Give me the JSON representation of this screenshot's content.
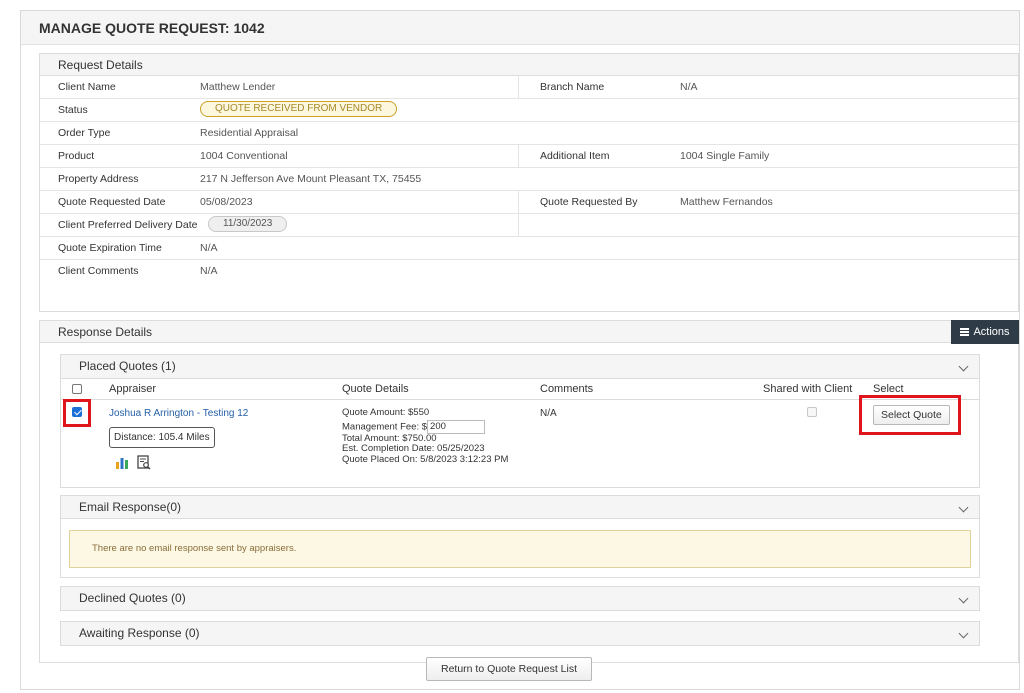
{
  "page": {
    "title": "MANAGE QUOTE REQUEST: 1042",
    "return_button": "Return to Quote Request List"
  },
  "request_details": {
    "title": "Request Details",
    "client_name_label": "Client Name",
    "client_name": "Matthew Lender",
    "branch_name_label": "Branch Name",
    "branch_name": "N/A",
    "status_label": "Status",
    "status": "QUOTE RECEIVED FROM VENDOR",
    "order_type_label": "Order Type",
    "order_type": "Residential Appraisal",
    "product_label": "Product",
    "product": "1004 Conventional",
    "additional_item_label": "Additional Item",
    "additional_item": "1004 Single Family",
    "property_address_label": "Property Address",
    "property_address": "217 N Jefferson Ave Mount Pleasant TX, 75455",
    "quote_requested_date_label": "Quote Requested Date",
    "quote_requested_date": "05/08/2023",
    "quote_requested_by_label": "Quote Requested By",
    "quote_requested_by": "Matthew Fernandos",
    "preferred_delivery_label": "Client Preferred Delivery Date",
    "preferred_delivery": "11/30/2023",
    "quote_expiration_label": "Quote Expiration Time",
    "quote_expiration": "N/A",
    "client_comments_label": "Client Comments",
    "client_comments": "N/A"
  },
  "response_details": {
    "title": "Response Details",
    "actions_label": "Actions",
    "placed_quotes": {
      "title": "Placed Quotes (1)",
      "columns": {
        "appraiser": "Appraiser",
        "quote_details": "Quote Details",
        "comments": "Comments",
        "shared": "Shared with Client",
        "select": "Select"
      },
      "rows": [
        {
          "appraiser": "Joshua R Arrington - Testing 12",
          "distance": "Distance: 105.4 Miles",
          "quote_amount": "Quote Amount:  $550",
          "management_fee_label": "Management Fee: $",
          "management_fee": "200",
          "total_amount": "Total Amount: $750.00",
          "completion_date": "Est. Completion Date:  05/25/2023",
          "placed_on": "Quote Placed On: 5/8/2023 3:12:23 PM",
          "comments": "N/A",
          "select_label": "Select Quote"
        }
      ]
    },
    "email_response": {
      "title": "Email Response(0)",
      "notice": "There are no email response sent by appraisers."
    },
    "declined_quotes": {
      "title": "Declined Quotes (0)"
    },
    "awaiting_response": {
      "title": "Awaiting Response (0)"
    }
  },
  "colors": {
    "highlight_red": "#e0141c",
    "actions_bg": "#2f3b47",
    "link_blue": "#2460a7",
    "status_yellow": "#c9a227"
  }
}
